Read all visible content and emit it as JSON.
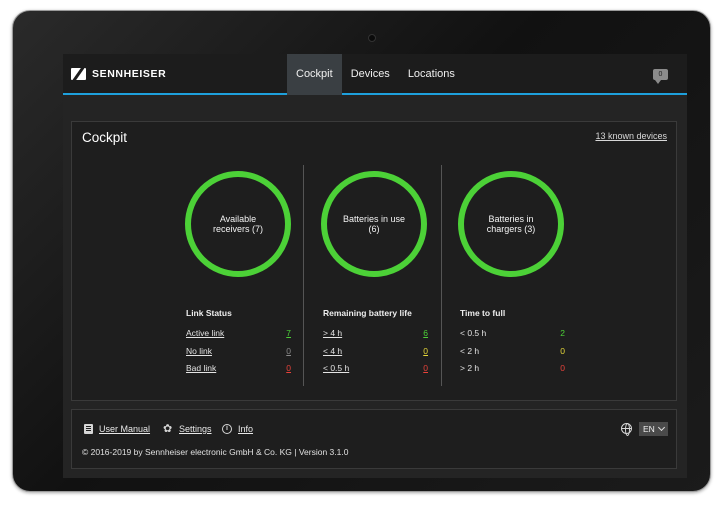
{
  "header": {
    "brand": "SENNHEISER",
    "nav": [
      {
        "label": "Cockpit",
        "active": true
      },
      {
        "label": "Devices",
        "active": false
      },
      {
        "label": "Locations",
        "active": false
      }
    ],
    "notifications_count": "0"
  },
  "cockpit": {
    "title": "Cockpit",
    "known_devices_link": "13 known devices",
    "rings": [
      {
        "label": "Available receivers (7)"
      },
      {
        "label": "Batteries in use (6)"
      },
      {
        "label": "Batteries in chargers (3)"
      }
    ],
    "ring_color": "#4cd137",
    "link_status": {
      "title": "Link Status",
      "rows": [
        {
          "label": "Active link",
          "value": "7",
          "color": "#4cd137"
        },
        {
          "label": "No link",
          "value": "0",
          "color": "#8a8a8a"
        },
        {
          "label": "Bad link",
          "value": "0",
          "color": "#e8423a"
        }
      ]
    },
    "battery_life": {
      "title": "Remaining battery life",
      "rows": [
        {
          "label": "> 4 h",
          "value": "6",
          "color": "#4cd137"
        },
        {
          "label": "< 4 h",
          "value": "0",
          "color": "#e6d83a"
        },
        {
          "label": "< 0.5 h",
          "value": "0",
          "color": "#e8423a"
        }
      ]
    },
    "time_to_full": {
      "title": "Time to full",
      "rows": [
        {
          "label": "< 0.5 h",
          "value": "2",
          "color": "#4cd137"
        },
        {
          "label": "< 2 h",
          "value": "0",
          "color": "#e6d83a"
        },
        {
          "label": "> 2 h",
          "value": "0",
          "color": "#e8423a"
        }
      ]
    }
  },
  "footer": {
    "user_manual": "User Manual",
    "settings": "Settings",
    "info": "Info",
    "copyright": "© 2016-2019 by Sennheiser electronic GmbH & Co. KG | Version 3.1.0",
    "language": "EN"
  },
  "icons": {
    "brand": "sennheiser-logo-icon",
    "notifications": "chat-bubble-icon",
    "user_manual": "book-icon",
    "settings": "gear-icon",
    "info": "info-icon",
    "language": "globe-icon"
  },
  "accent_color": "#1ea0dc"
}
